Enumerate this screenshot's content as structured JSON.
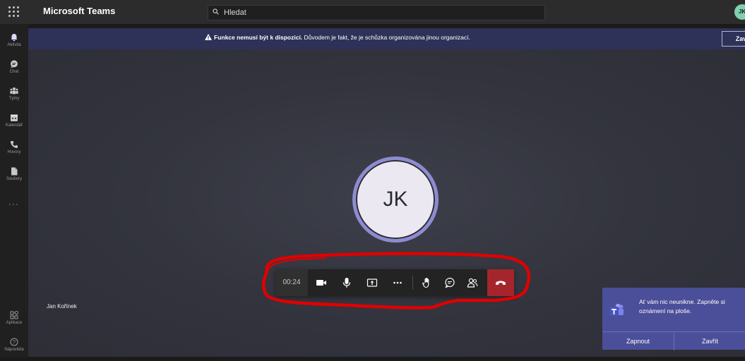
{
  "topbar": {
    "app_title": "Microsoft Teams",
    "search_placeholder": "Hledat",
    "profile_initials": "JK"
  },
  "rail": {
    "items": [
      {
        "label": "Aktivita",
        "icon": "bell-icon"
      },
      {
        "label": "Chat",
        "icon": "chat-icon"
      },
      {
        "label": "Týmy",
        "icon": "teams-icon"
      },
      {
        "label": "Kalendář",
        "icon": "calendar-icon"
      },
      {
        "label": "Hovory",
        "icon": "phone-icon"
      },
      {
        "label": "Soubory",
        "icon": "file-icon"
      }
    ],
    "more": "···",
    "bottom": [
      {
        "label": "Aplikace",
        "icon": "apps-icon"
      },
      {
        "label": "Nápověda",
        "icon": "help-icon"
      }
    ]
  },
  "banner": {
    "bold": "Funkce nemusí být k dispozici.",
    "text": " Důvodem je fakt, že je schůzka organizována jinou organizací.",
    "close_label": "Zavřít"
  },
  "call": {
    "avatar_initials": "JK",
    "participant_name": "Jan Kořínek",
    "timer": "00:24"
  },
  "toast": {
    "message": "Ať vám nic neunikne. Zapněte si oznámení na ploše.",
    "enable_label": "Zapnout",
    "close_label": "Zavřít"
  },
  "colors": {
    "banner_bg": "#2e3158",
    "hangup": "#a4262c",
    "toast_bg": "#4b4f99",
    "annotation": "#e00000",
    "avatar_ring": "#8d8bd0"
  }
}
